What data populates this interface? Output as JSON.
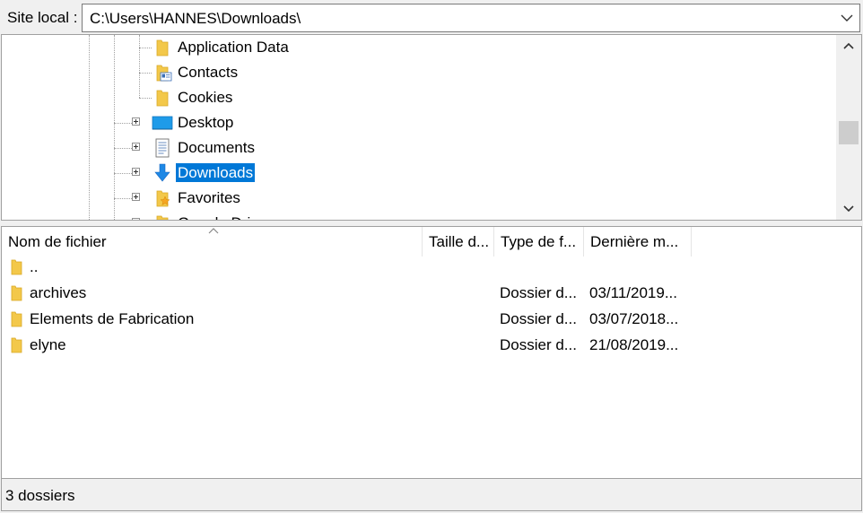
{
  "pathbar": {
    "label": "Site local :",
    "value": "C:\\Users\\HANNES\\Downloads\\"
  },
  "tree": {
    "items": [
      {
        "label": "Application Data",
        "icon": "folder-icon",
        "expandable": false,
        "selected": false
      },
      {
        "label": "Contacts",
        "icon": "contacts-icon",
        "expandable": false,
        "selected": false
      },
      {
        "label": "Cookies",
        "icon": "folder-icon",
        "expandable": false,
        "selected": false
      },
      {
        "label": "Desktop",
        "icon": "desktop-icon",
        "expandable": true,
        "selected": false
      },
      {
        "label": "Documents",
        "icon": "documents-icon",
        "expandable": true,
        "selected": false
      },
      {
        "label": "Downloads",
        "icon": "download-arrow-icon",
        "expandable": true,
        "selected": true
      },
      {
        "label": "Favorites",
        "icon": "favorites-folder-icon",
        "expandable": true,
        "selected": false
      },
      {
        "label": "Google Drive",
        "icon": "folder-icon",
        "expandable": true,
        "selected": false
      }
    ]
  },
  "filelist": {
    "columns": [
      "Nom de fichier",
      "Taille d...",
      "Type de f...",
      "Dernière m..."
    ],
    "sort_column": "Nom de fichier",
    "rows": [
      {
        "name": "..",
        "type": "",
        "date": ""
      },
      {
        "name": "archives",
        "type": "Dossier d...",
        "date": "03/11/2019..."
      },
      {
        "name": "Elements de Fabrication",
        "type": "Dossier d...",
        "date": "03/07/2018..."
      },
      {
        "name": "elyne",
        "type": "Dossier d...",
        "date": "21/08/2019..."
      }
    ]
  },
  "status": {
    "text": "3 dossiers"
  },
  "colors": {
    "selection": "#0078d7",
    "folder": "#f3c84a",
    "download_arrow": "#1e88e5"
  }
}
